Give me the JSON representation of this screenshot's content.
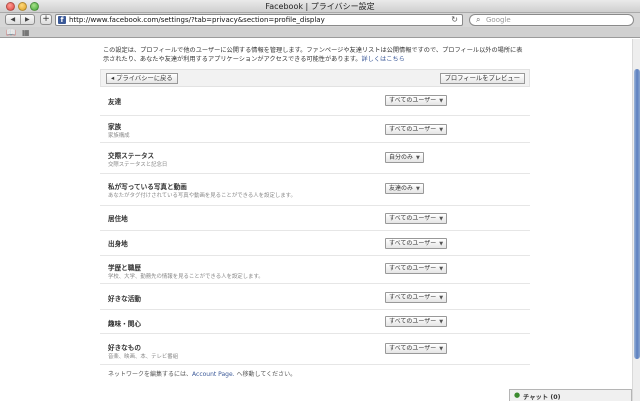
{
  "window": {
    "title": "Facebook | プライバシー設定"
  },
  "toolbar": {
    "back_icon": "◀",
    "forward_icon": "▶",
    "plus": "+",
    "url": "http://www.facebook.com/settings/?tab=privacy&section=profile_display",
    "favicon": "f",
    "reload_icon": "↻",
    "search_placeholder": "Google"
  },
  "bookmarks": {
    "book_icon": "📖",
    "grid_icon": "▦"
  },
  "intro": {
    "text": "この設定は、プロフィールで他のユーザーに公開する情報を管理します。ファンページや友達リストは公開情報ですので、プロフィール以外の場所に表示されたり、あなたや友達が利用するアプリケーションがアクセスできる可能性があります。",
    "link": "詳しくはこちら"
  },
  "header": {
    "back_button": "◂ プライバシーに戻る",
    "preview_button": "プロフィールをプレビュー"
  },
  "rows": [
    {
      "label": "友達",
      "sub": "",
      "value": "すべてのユーザー"
    },
    {
      "label": "家族",
      "sub": "家族構成",
      "value": "すべてのユーザー"
    },
    {
      "label": "交際ステータス",
      "sub": "交際ステータスと記念日",
      "value": "自分のみ"
    },
    {
      "label": "私が写っている写真と動画",
      "sub": "あなたがタグ付けされている写真や動画を見ることができる人を設定します。",
      "value": "友達のみ"
    },
    {
      "label": "居住地",
      "sub": "",
      "value": "すべてのユーザー"
    },
    {
      "label": "出身地",
      "sub": "",
      "value": "すべてのユーザー"
    },
    {
      "label": "学歴と職歴",
      "sub": "学校、大学、勤務先の情報を見ることができる人を設定します。",
      "value": "すべてのユーザー"
    },
    {
      "label": "好きな活動",
      "sub": "",
      "value": "すべてのユーザー"
    },
    {
      "label": "趣味・関心",
      "sub": "",
      "value": "すべてのユーザー"
    },
    {
      "label": "好きなもの",
      "sub": "音楽、映画、本、テレビ番組",
      "value": "すべてのユーザー"
    }
  ],
  "footer": {
    "note_before": "ネットワークを編集するには、",
    "note_link": "Account Page.",
    "note_after": " へ移動してください。"
  },
  "chat": {
    "label": "チャット (0)",
    "icon": "●"
  }
}
